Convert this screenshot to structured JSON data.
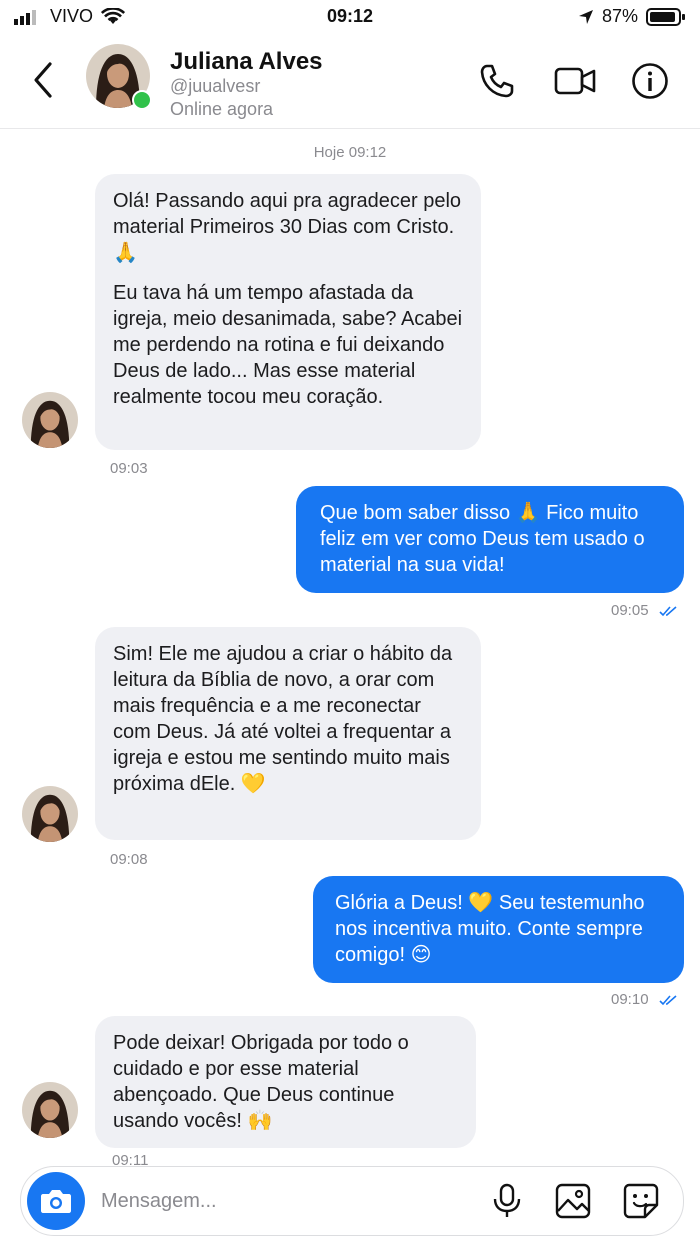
{
  "status": {
    "carrier": "VIVO",
    "time": "09:12",
    "battery": "87%"
  },
  "header": {
    "name": "Juliana Alves",
    "handle": "@juualvesr",
    "presence": "Online agora"
  },
  "day_label": "Hoje 09:12",
  "messages": [
    {
      "p1": "Olá! Passando aqui pra agradecer pelo material Primeiros 30 Dias com Cristo. 🙏",
      "p2": "Eu tava há um tempo afastada da igreja, meio desanimada, sabe? Acabei me perdendo na rotina e fui deixando Deus de lado... Mas esse material realmente tocou meu coração.",
      "time": "09:03"
    },
    {
      "p1": "Que bom saber disso 🙏 Fico muito feliz em ver como Deus tem usado o material na sua vida!",
      "time": "09:05"
    },
    {
      "p1": "Sim! Ele me ajudou a criar o hábito da leitura da Bíblia de novo, a orar com mais frequência e a me reconectar com Deus. Já até voltei a frequentar a igreja e estou me sentindo muito mais próxima dEle. 💛",
      "time": "09:08"
    },
    {
      "p1": "Glória a Deus! 💛 Seu testemunho nos incentiva muito. Conte sempre comigo! 😊",
      "time": "09:10"
    },
    {
      "p1": "Pode deixar! Obrigada por todo o cuidado e por esse material abençoado. Que Deus continue usando vocês! 🙌",
      "time": "09:11"
    }
  ],
  "composer": {
    "placeholder": "Mensagem..."
  },
  "colors": {
    "accent": "#1877f2",
    "incoming": "#eff0f4",
    "online": "#31c24b"
  }
}
